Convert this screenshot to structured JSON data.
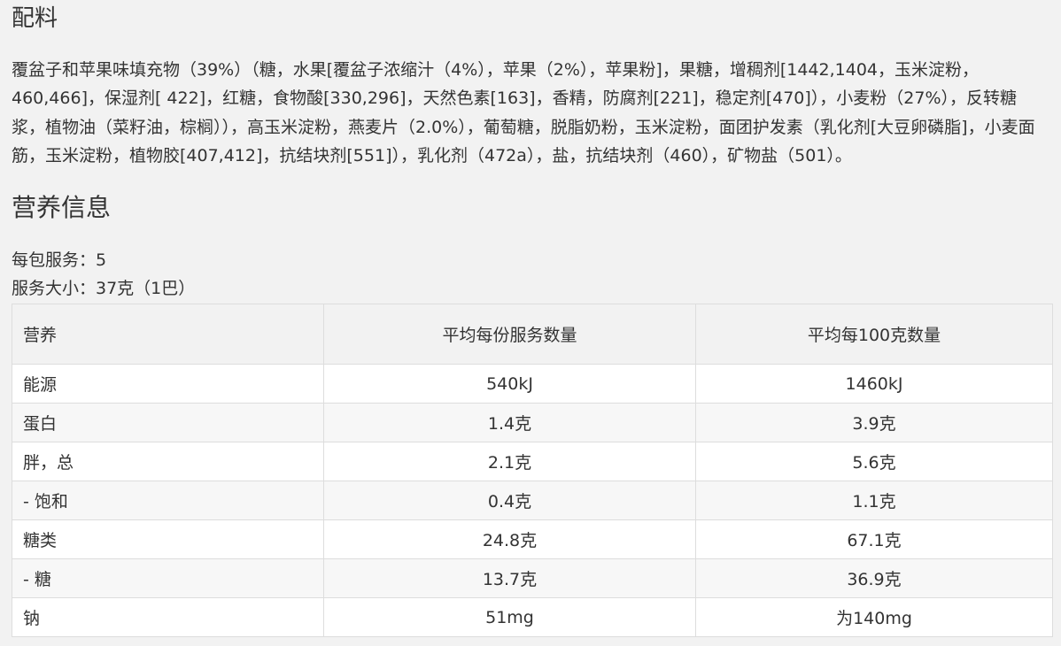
{
  "ingredients": {
    "heading": "配料",
    "text": "覆盆子和苹果味填充物（39%）（糖，水果[覆盆子浓缩汁（4%），苹果（2%），苹果粉]，果糖，增稠剂[1442,1404，玉米淀粉，460,466]，保湿剂[ 422]，红糖，食物酸[330,296]，天然色素[163]，香精，防腐剂[221]，稳定剂[470]），小麦粉（27%），反转糖浆，植物油（菜籽油，棕榈）），高玉米淀粉，燕麦片（2.0%），葡萄糖，脱脂奶粉，玉米淀粉，面团护发素（乳化剂[大豆卵磷脂]，小麦面筋，玉米淀粉，植物胶[407,412]，抗结块剂[551]），乳化剂（472a），盐，抗结块剂（460），矿物盐（501）。"
  },
  "nutrition": {
    "heading": "营养信息",
    "servings_per_pack": "每包服务：5",
    "serving_size": "服务大小：37克（1巴）",
    "table": {
      "headers": [
        "营养",
        "平均每份服务数量",
        "平均每100克数量"
      ],
      "rows": [
        [
          "能源",
          "540kJ",
          "1460kJ"
        ],
        [
          "蛋白",
          "1.4克",
          "3.9克"
        ],
        [
          "胖，总",
          "2.1克",
          "5.6克"
        ],
        [
          "- 饱和",
          "0.4克",
          "1.1克"
        ],
        [
          "糖类",
          "24.8克",
          "67.1克"
        ],
        [
          "- 糖",
          "13.7克",
          "36.9克"
        ],
        [
          "钠",
          "51mg",
          "为140mg"
        ]
      ]
    }
  },
  "colors": {
    "background": "#f2f2f2",
    "text": "#333333",
    "border": "#dddddd",
    "row_odd": "#ffffff",
    "row_even": "#f7f7f7"
  }
}
